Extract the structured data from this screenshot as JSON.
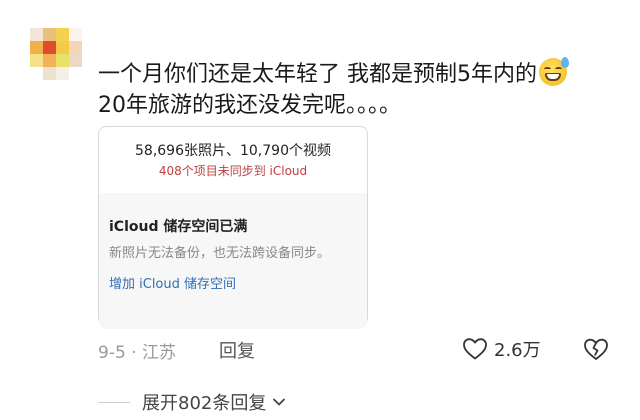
{
  "comment": {
    "line1": "一个月你们还是太年轻了 我都是预制5年内的",
    "line2": "20年旅游的我还没发完呢。。。。",
    "emoji_icon": "grinning-face-with-sweat-icon"
  },
  "card": {
    "stat_line": "58,696张照片、10,790个视频",
    "unsynced_line": "408个项目未同步到 iCloud",
    "storage_title": "iCloud 储存空间已满",
    "storage_desc": "新照片无法备份，也无法跨设备同步。",
    "add_storage_link": "增加 iCloud 储存空间"
  },
  "meta": {
    "date_location": "9-5 · 江苏",
    "reply_label": "回复",
    "like_count": "2.6万",
    "like_icon": "heart-outline-icon",
    "dislike_icon": "broken-heart-icon"
  },
  "expand": {
    "label": "展开802条回复",
    "chevron_icon": "chevron-down-icon"
  },
  "colors": {
    "unsynced_red": "#c04040",
    "link_blue": "#2f6fb5",
    "meta_gray": "#9a9a9a"
  }
}
